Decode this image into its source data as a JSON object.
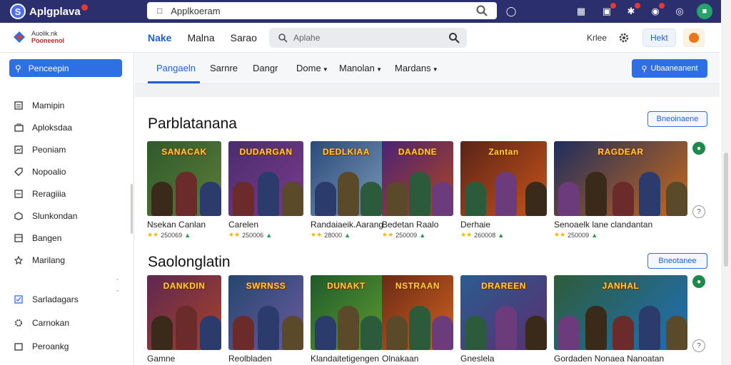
{
  "app": {
    "name": "Aplgplava"
  },
  "urlbar": {
    "url": "Applkoeram"
  },
  "header": {
    "logo_line1": "Auolik.nk",
    "logo_line2": "Pooneenol",
    "nav": [
      "Nake",
      "Malna",
      "Sarao"
    ],
    "search_placeholder": "Aplahe",
    "right_label": "Krlee",
    "right_button": "Hekt"
  },
  "sidebar": {
    "search_label": "Penceepin",
    "items": [
      {
        "label": "Mamipin",
        "icon": "document-icon"
      },
      {
        "label": "Aploksdaa",
        "icon": "bag-icon"
      },
      {
        "label": "Peoniam",
        "icon": "image-icon"
      },
      {
        "label": "Nopoalio",
        "icon": "tag-icon"
      },
      {
        "label": "Reragiiia",
        "icon": "list-icon"
      },
      {
        "label": "Slunkondan",
        "icon": "box-icon"
      },
      {
        "label": "Bangen",
        "icon": "grid-icon"
      },
      {
        "label": "Marilang",
        "icon": "star-icon"
      },
      {
        "label": "Sarladagars",
        "icon": "checkbox-icon"
      },
      {
        "label": "Carnokan",
        "icon": "gear-icon"
      },
      {
        "label": "Peroankg",
        "icon": "cart-icon"
      }
    ]
  },
  "tabs": {
    "items": [
      "Pangaeln",
      "Sarnre",
      "Dangr",
      "Dome",
      "Manolan",
      "Mardans"
    ],
    "action_button": "Ubaaneanent"
  },
  "sections": [
    {
      "title": "Parblatanana",
      "button": "Bneoinaene",
      "cards": [
        {
          "name": "Nsekan Canlan",
          "rating": "250069",
          "thumb_title": "SANACAK",
          "bg": [
            "#2e5a2a",
            "#5e7d3a"
          ]
        },
        {
          "name": "Carelen",
          "rating": "250006",
          "thumb_title": "DUDARGAN",
          "bg": [
            "#4a2d6d",
            "#7a3b8c"
          ]
        },
        {
          "name": "Randaiaeik.Aarang",
          "rating": "28000",
          "thumb_title": "DEDLKIAA",
          "bg": [
            "#2a4a7a",
            "#7a9ab8"
          ]
        },
        {
          "name": "Bedetan Raalo",
          "rating": "250009",
          "thumb_title": "DAADNE",
          "bg": [
            "#4b2375",
            "#b0451f"
          ]
        },
        {
          "name": "Derhaie",
          "rating": "260008",
          "thumb_title": "Zantan",
          "bg": [
            "#5a2418",
            "#c8531a"
          ]
        },
        {
          "name": "Senoaelk lane clandantan",
          "rating": "250009",
          "thumb_title": "RAGDEAR",
          "bg": [
            "#1f2d5e",
            "#c66a1c"
          ]
        }
      ]
    },
    {
      "title": "Saolonglatin",
      "button": "Bneotanee",
      "cards": [
        {
          "name": "Gamne",
          "rating": "",
          "thumb_title": "DANKDIN",
          "bg": [
            "#5e2850",
            "#a8422a"
          ]
        },
        {
          "name": "Reolbladen",
          "rating": "",
          "thumb_title": "SWRNSS",
          "bg": [
            "#24466e",
            "#6d5aa0"
          ]
        },
        {
          "name": "Klandaitetigengen",
          "rating": "",
          "thumb_title": "DUNAKT",
          "bg": [
            "#1f5a2c",
            "#5e9b2e"
          ]
        },
        {
          "name": "Olnakaan",
          "rating": "",
          "thumb_title": "NSTRAAN",
          "bg": [
            "#6a2a16",
            "#d1621f"
          ]
        },
        {
          "name": "Gneslela",
          "rating": "",
          "thumb_title": "DRAREEN",
          "bg": [
            "#2a5c8f",
            "#5a2e70"
          ]
        },
        {
          "name": "Gordaden Nonaea Nanoatan",
          "rating": "",
          "thumb_title": "JANHAL",
          "bg": [
            "#2e5c3a",
            "#1f6fb8"
          ]
        }
      ]
    }
  ],
  "colors": {
    "accent": "#2f6fe4",
    "topbar": "#2b2f6e",
    "star": "#f4b400"
  }
}
